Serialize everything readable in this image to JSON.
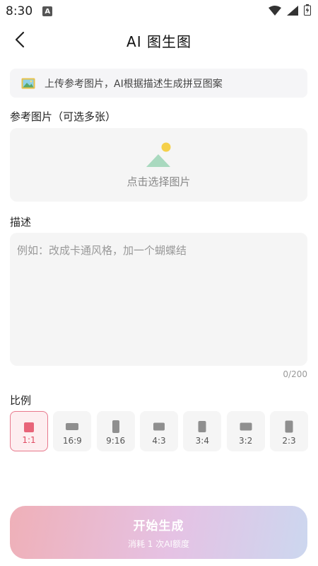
{
  "status_bar": {
    "time": "8:30",
    "a_badge": "A"
  },
  "header": {
    "title": "AI 图生图",
    "back_icon": "chevron-left-icon"
  },
  "tip": {
    "icon": "image-icon",
    "text": "上传参考图片，AI根据描述生成拼豆图案"
  },
  "reference": {
    "label": "参考图片（可选多张）",
    "upload_text": "点击选择图片",
    "upload_icon": "mountain-sun-icon"
  },
  "description": {
    "label": "描述",
    "placeholder": "例如：改成卡通风格，加一个蝴蝶结",
    "value": "",
    "counter": "0/200"
  },
  "ratio": {
    "label": "比例",
    "selected": "1:1",
    "options": [
      {
        "label": "1:1",
        "active": true
      },
      {
        "label": "16:9",
        "active": false
      },
      {
        "label": "9:16",
        "active": false
      },
      {
        "label": "4:3",
        "active": false
      },
      {
        "label": "3:4",
        "active": false
      },
      {
        "label": "3:2",
        "active": false
      },
      {
        "label": "2:3",
        "active": false
      }
    ]
  },
  "start_button": {
    "label": "开始生成",
    "sub": "消耗 1 次AI额度"
  },
  "colors": {
    "accent": "#e86479",
    "gradient_start": "#efb0b8",
    "gradient_end": "#ccd7ef"
  }
}
